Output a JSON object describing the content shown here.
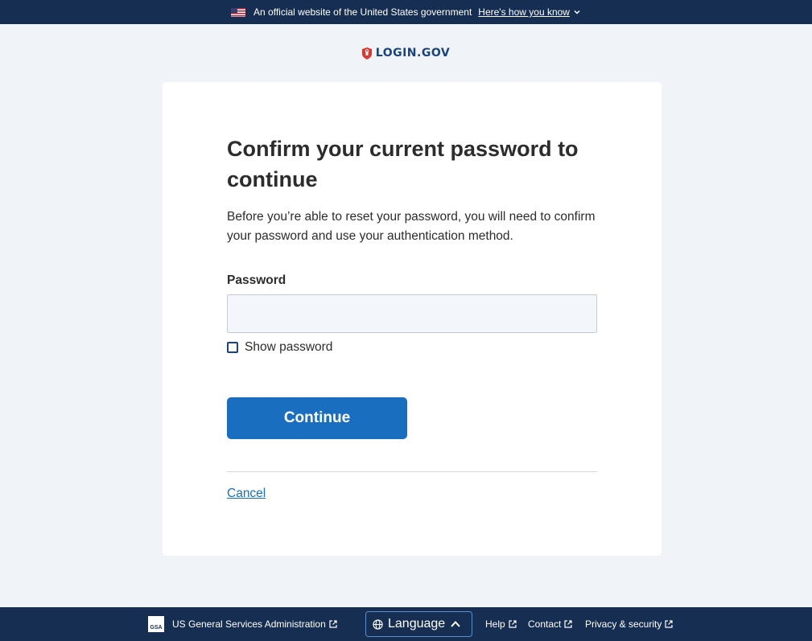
{
  "banner": {
    "text": "An official website of the United States government",
    "link": "Here's how you know"
  },
  "logo": {
    "text": "LOGIN.GOV"
  },
  "main": {
    "title": "Confirm your current password to continue",
    "description": "Before you’re able to reset your password, you will need to confirm your password and use your authentication method.",
    "password_label": "Password",
    "password_value": "",
    "show_password_label": "Show password",
    "continue_label": "Continue",
    "cancel_label": "Cancel"
  },
  "footer": {
    "gsa_logo_text": "GSA",
    "gsa": "US General Services Administration",
    "language": "Language",
    "help": "Help",
    "contact": "Contact",
    "privacy": "Privacy & security"
  },
  "colors": {
    "navy": "#162e51",
    "primary_button": "#1a6ec0",
    "logo_red": "#d83933",
    "page_bg": "#f0f3f7"
  }
}
